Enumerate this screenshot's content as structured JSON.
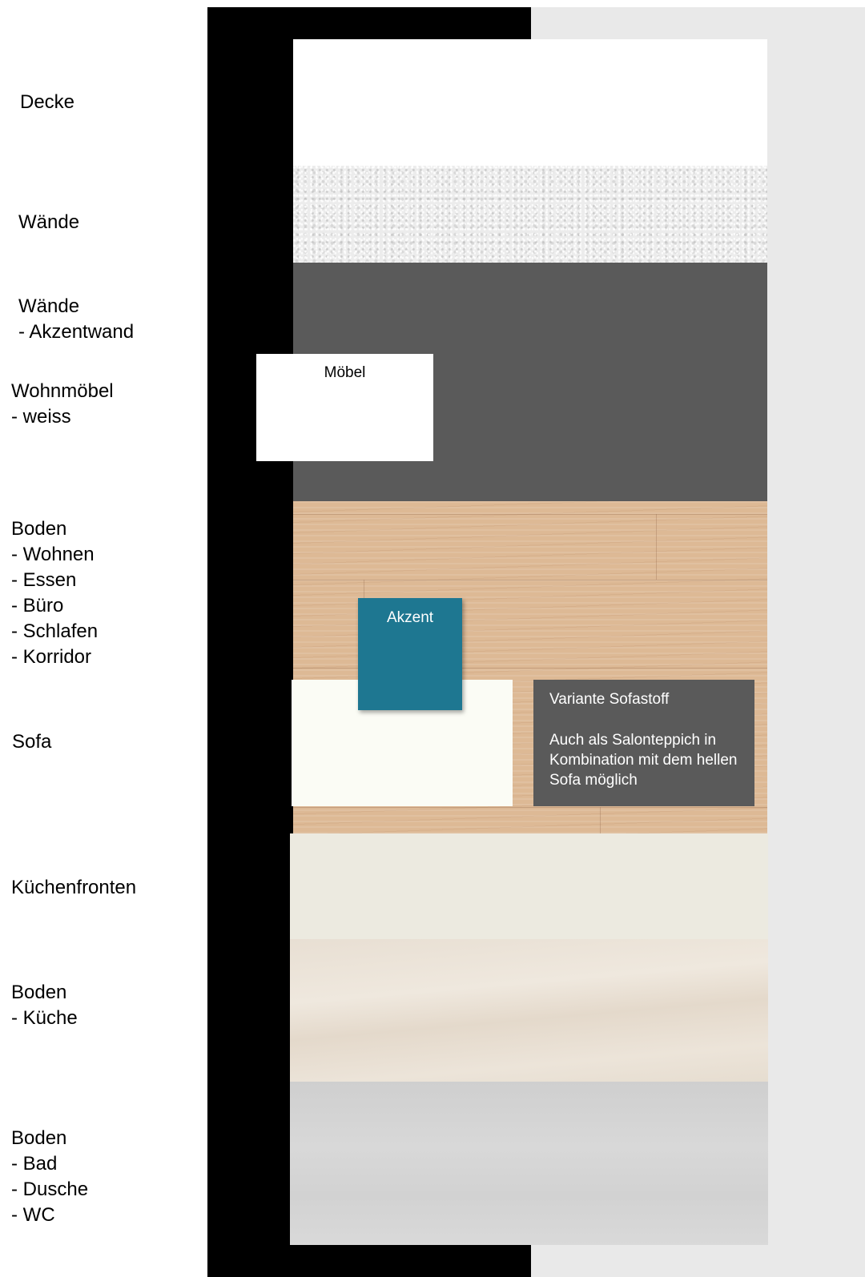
{
  "labels": {
    "decke": "Decke",
    "waende": "Wände",
    "akzentwand": "Wände\n - Akzentwand",
    "wohnmoebel": "Wohnmöbel\n- weiss",
    "boden_wohnen": "Boden\n- Wohnen\n- Essen\n- Büro\n- Schlafen\n- Korridor",
    "sofa": "Sofa",
    "kuechenfronten": "Küchenfronten",
    "boden_kueche": "Boden\n- Küche",
    "boden_bad": "Boden\n- Bad\n- Dusche\n- WC"
  },
  "cards": {
    "moebel": "Möbel",
    "akzent": "Akzent",
    "variante_title": "Variante Sofastoff",
    "variante_text": "Auch als Salonteppich in Kombination mit dem hellen Sofa möglich"
  },
  "colors": {
    "accent_wall": "#5a5a5a",
    "accent_teal": "#1e7791",
    "wood": "#ddb995",
    "kitchen_front": "#eceae0"
  }
}
